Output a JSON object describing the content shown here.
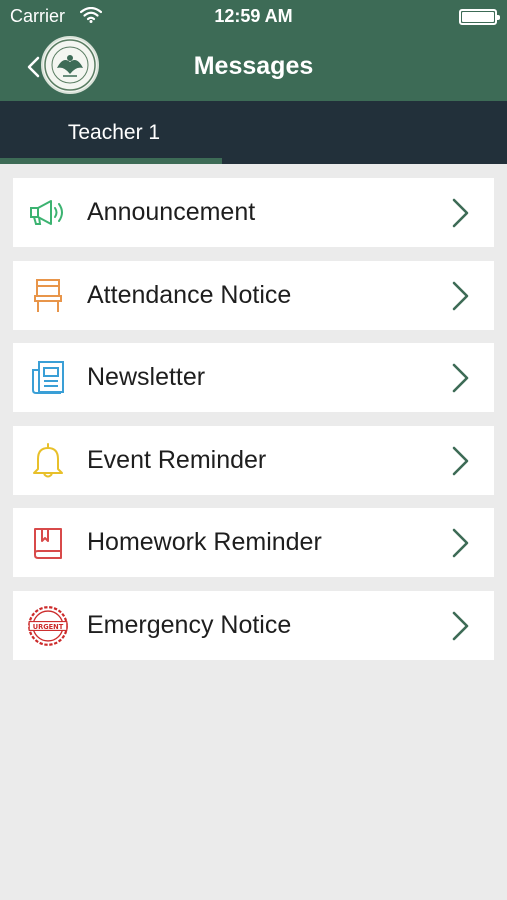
{
  "status_bar": {
    "carrier": "Carrier",
    "time": "12:59 AM"
  },
  "header": {
    "title": "Messages"
  },
  "tabs": [
    {
      "label": "Teacher 1",
      "active": true
    }
  ],
  "colors": {
    "header": "#3d6b56",
    "tab_bar": "#22303a",
    "background": "#ebebeb",
    "chevron": "#3d6b56"
  },
  "messages": [
    {
      "label": "Announcement",
      "icon": "megaphone-icon",
      "color": "#3cb371"
    },
    {
      "label": "Attendance Notice",
      "icon": "chair-icon",
      "color": "#e8954a"
    },
    {
      "label": "Newsletter",
      "icon": "newspaper-icon",
      "color": "#3a9fd6"
    },
    {
      "label": "Event Reminder",
      "icon": "bell-icon",
      "color": "#e8c02a"
    },
    {
      "label": "Homework Reminder",
      "icon": "book-icon",
      "color": "#d84a4a"
    },
    {
      "label": "Emergency Notice",
      "icon": "urgent-stamp-icon",
      "color": "#cc2a2a",
      "stamp_text": "URGENT"
    }
  ]
}
